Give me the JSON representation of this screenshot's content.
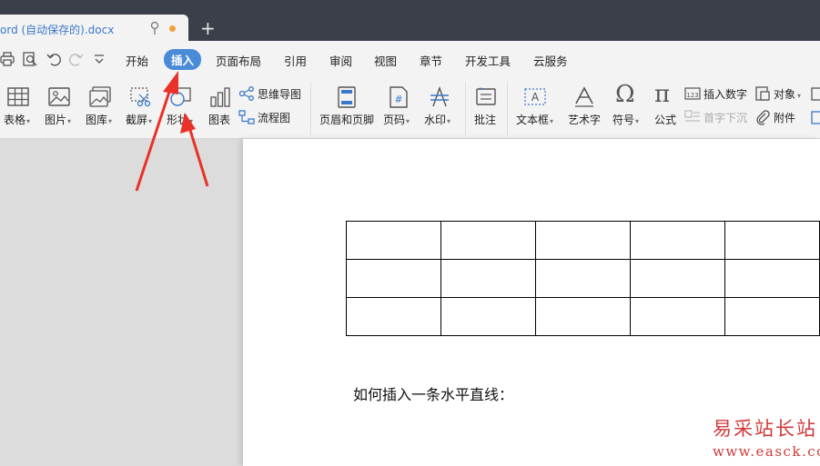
{
  "tab": {
    "title": "ord (自动保存的).docx"
  },
  "menu": {
    "items": [
      "开始",
      "插入",
      "页面布局",
      "引用",
      "审阅",
      "视图",
      "章节",
      "开发工具",
      "云服务"
    ],
    "active": "插入"
  },
  "ribbon": {
    "table": "表格",
    "picture": "图片",
    "gallery": "图库",
    "screenshot": "截屏",
    "shape": "形状",
    "chart": "图表",
    "mindmap": "思维导图",
    "flowchart": "流程图",
    "header_footer": "页眉和页脚",
    "page_number": "页码",
    "watermark": "水印",
    "comment": "批注",
    "textbox": "文本框",
    "wordart": "艺术字",
    "symbol": "符号",
    "formula": "公式",
    "insert_number": "插入数字",
    "drop_cap": "首字下沉",
    "object": "对象",
    "attachment": "附件"
  },
  "document": {
    "table": {
      "rows": 3,
      "cols": 5
    },
    "text": "如何插入一条水平直线："
  },
  "watermark": {
    "cn": "易采站长站",
    "url": "www.easck.com"
  },
  "colors": {
    "accent": "#4a8bd8",
    "annotation_arrow": "#e8322a",
    "titlebar": "#3b3f4a"
  }
}
